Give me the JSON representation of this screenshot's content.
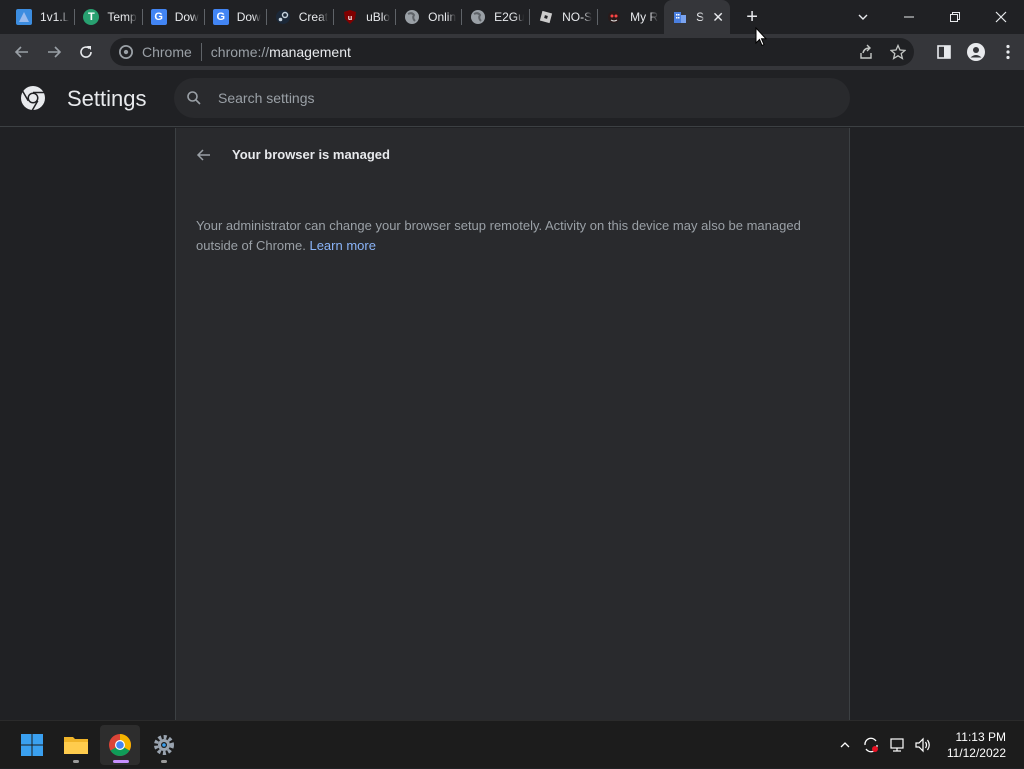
{
  "tabs": [
    {
      "label": "1v1.L",
      "favicon": "1v1-favicon",
      "color": "#3c8de0"
    },
    {
      "label": "Temp",
      "favicon": "temp-favicon",
      "color": "#28a070"
    },
    {
      "label": "Dow",
      "favicon": "google-docs-favicon",
      "color": "#4285f4",
      "glyph": "G"
    },
    {
      "label": "Dow",
      "favicon": "google-docs-favicon",
      "color": "#4285f4",
      "glyph": "G"
    },
    {
      "label": "Creat",
      "favicon": "steam-favicon",
      "color": "#1b2838"
    },
    {
      "label": "uBlo",
      "favicon": "ublock-favicon",
      "color": "#800000"
    },
    {
      "label": "Onlin",
      "favicon": "globe-favicon",
      "color": "#5f6368"
    },
    {
      "label": "E2Gu",
      "favicon": "globe-favicon",
      "color": "#5f6368"
    },
    {
      "label": "NO-S",
      "favicon": "roblox-favicon",
      "color": "#cccccc"
    },
    {
      "label": "My R",
      "favicon": "character-favicon",
      "color": "#a03030"
    }
  ],
  "active_tab": {
    "label": "S",
    "favicon": "building-favicon",
    "color": "#4a7fe0"
  },
  "omnibox": {
    "chip": "Chrome",
    "scheme": "chrome://",
    "path": "management"
  },
  "settings": {
    "title": "Settings",
    "search_placeholder": "Search settings"
  },
  "page": {
    "heading": "Your browser is managed",
    "description": "Your administrator can change your browser setup remotely. Activity on this device may also be managed outside of Chrome.",
    "learn_more": "Learn more"
  },
  "taskbar": {
    "time": "11:13 PM",
    "date": "11/12/2022"
  },
  "colors": {
    "accent": "#8ab4f8",
    "background": "#202124",
    "panel": "#292a2d"
  }
}
